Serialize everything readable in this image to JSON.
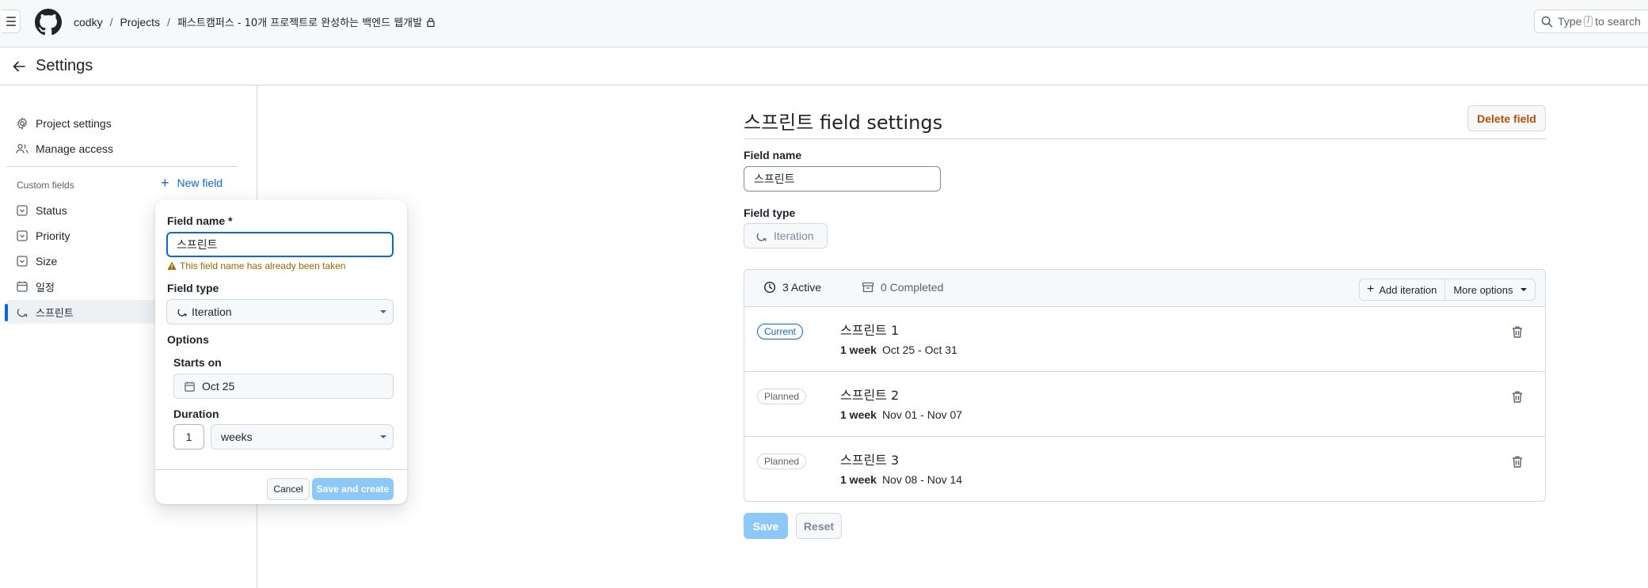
{
  "header": {
    "owner": "codky",
    "projects": "Projects",
    "project_title": "패스트캠퍼스 - 10개 프로젝트로 완성하는 백엔드 웹개발",
    "search_prefix": "Type",
    "search_key": "/",
    "search_suffix": "to search"
  },
  "settings_title": "Settings",
  "sidebar": {
    "project_settings": "Project settings",
    "manage_access": "Manage access",
    "custom_fields_label": "Custom fields",
    "new_field": "New field",
    "fields": [
      "Status",
      "Priority",
      "Size",
      "일정",
      "스프린트"
    ]
  },
  "popover": {
    "field_name_label": "Field name *",
    "field_name_value": "스프린트",
    "error": "This field name has already been taken",
    "field_type_label": "Field type",
    "field_type_value": "Iteration",
    "options_label": "Options",
    "starts_on_label": "Starts on",
    "starts_on_value": "Oct 25",
    "duration_label": "Duration",
    "duration_value": "1",
    "duration_unit": "weeks",
    "cancel": "Cancel",
    "save_and_create": "Save and create"
  },
  "main": {
    "title": "스프린트 field settings",
    "delete_field": "Delete field",
    "field_name_label": "Field name",
    "field_name_value": "스프린트",
    "field_type_label": "Field type",
    "field_type_value": "Iteration",
    "tab_active": "3 Active",
    "tab_completed": "0 Completed",
    "add_iteration": "Add iteration",
    "more_options": "More options",
    "iterations": [
      {
        "badge": "Current",
        "name": "스프린트 1",
        "duration": "1 week",
        "range": "Oct 25 - Oct 31"
      },
      {
        "badge": "Planned",
        "name": "스프린트 2",
        "duration": "1 week",
        "range": "Nov 01 - Nov 07"
      },
      {
        "badge": "Planned",
        "name": "스프린트 3",
        "duration": "1 week",
        "range": "Nov 08 - Nov 14"
      }
    ],
    "save": "Save",
    "reset": "Reset"
  }
}
